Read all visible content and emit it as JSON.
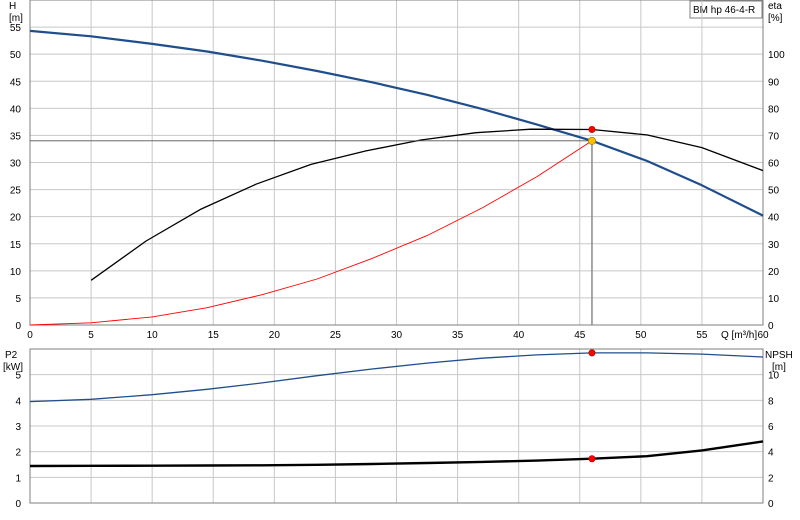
{
  "colors": {
    "head_curve": "#1f4e8c",
    "eta_curve": "#000000",
    "system_curve": "#ff0000",
    "p2_curve": "#1f4e8c",
    "npsh_curve": "#000000",
    "marker": "#ff0000",
    "duty_point": "#ffc000",
    "grid": "#c8c8c8"
  },
  "chart_data": [
    {
      "type": "line",
      "legend_label": "BM hp 46-4-R",
      "xlabel": "Q [m³/h]",
      "ylabel": "H",
      "ylabel_unit": "[m]",
      "y2label": "eta",
      "y2label_unit": "[%]",
      "xlim": [
        0,
        60
      ],
      "ylim": [
        0,
        60
      ],
      "y2lim": [
        0,
        120
      ],
      "x_ticks": [
        0,
        5,
        10,
        15,
        20,
        25,
        30,
        35,
        40,
        45,
        50,
        55,
        60
      ],
      "y_ticks": [
        0,
        5,
        10,
        15,
        20,
        25,
        30,
        35,
        40,
        45,
        50,
        55
      ],
      "y2_ticks": [
        0,
        10,
        20,
        30,
        40,
        50,
        60,
        70,
        80,
        90,
        100
      ],
      "grid": true,
      "series": [
        {
          "key": "H",
          "axis": "left",
          "x": [
            0,
            5,
            10,
            14.5,
            19,
            23.5,
            28,
            32.5,
            37,
            41.5,
            46,
            50.5,
            55,
            60
          ],
          "y": [
            54.3,
            53.3,
            51.9,
            50.5,
            48.8,
            46.9,
            44.8,
            42.5,
            39.9,
            37.0,
            34.0,
            30.3,
            25.8,
            20.2
          ]
        },
        {
          "key": "eta",
          "axis": "right",
          "x": [
            5,
            9.5,
            14,
            18.5,
            23,
            27.5,
            32,
            36.5,
            41,
            46,
            50.5,
            55,
            60
          ],
          "y": [
            16.5,
            31,
            42.8,
            52,
            59.3,
            64.3,
            68.3,
            71,
            72.3,
            72.2,
            70.2,
            65.5,
            57
          ]
        },
        {
          "key": "system",
          "axis": "left",
          "x": [
            0,
            5,
            10,
            14.5,
            19,
            23.5,
            28,
            32.5,
            37,
            41.5,
            46
          ],
          "y": [
            0,
            0.4,
            1.5,
            3.2,
            5.6,
            8.5,
            12.3,
            16.5,
            21.6,
            27.4,
            34.0
          ]
        }
      ],
      "markers": [
        {
          "x": 46,
          "y": 72.2,
          "axis": "right",
          "kind": "point"
        },
        {
          "x": 46,
          "y": 34.0,
          "axis": "left",
          "kind": "duty_point"
        }
      ]
    },
    {
      "type": "line",
      "ylabel": "P2",
      "ylabel_unit": "[kW]",
      "y2label": "NPSH",
      "y2label_unit": "[m]",
      "xlim": [
        0,
        60
      ],
      "ylim": [
        0,
        6
      ],
      "y2lim": [
        0,
        12
      ],
      "y_ticks": [
        0,
        1,
        2,
        3,
        4,
        5
      ],
      "y2_ticks": [
        0,
        2,
        4,
        6,
        8,
        10
      ],
      "grid": true,
      "series": [
        {
          "key": "P2",
          "axis": "left",
          "x": [
            0,
            5,
            10,
            14.5,
            19,
            23.5,
            28,
            32.5,
            37,
            41.5,
            46,
            50.5,
            55,
            60
          ],
          "y": [
            3.95,
            4.04,
            4.22,
            4.43,
            4.68,
            4.96,
            5.22,
            5.45,
            5.64,
            5.77,
            5.85,
            5.85,
            5.8,
            5.69
          ]
        },
        {
          "key": "NPSH",
          "axis": "right",
          "x": [
            0,
            5,
            10,
            14.5,
            19,
            23.5,
            28,
            32.5,
            37,
            41.5,
            46,
            50.5,
            55,
            60
          ],
          "y": [
            2.88,
            2.9,
            2.91,
            2.92,
            2.94,
            2.98,
            3.04,
            3.12,
            3.2,
            3.3,
            3.45,
            3.65,
            4.1,
            4.8
          ]
        }
      ],
      "markers": [
        {
          "x": 46,
          "y": 5.85,
          "axis": "left",
          "kind": "point"
        },
        {
          "x": 46,
          "y": 3.45,
          "axis": "right",
          "kind": "point"
        }
      ]
    }
  ]
}
